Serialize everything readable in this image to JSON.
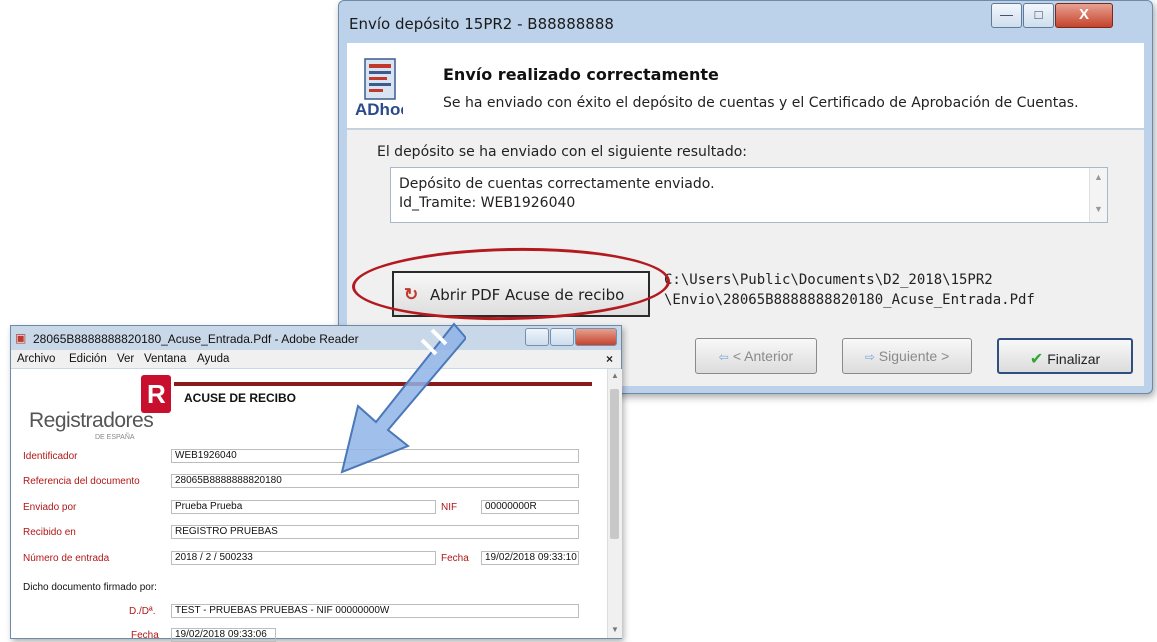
{
  "dialog": {
    "title": "Envío depósito 15PR2 - B88888888",
    "window_buttons": {
      "minimize": "—",
      "maximize": "□",
      "close": "X"
    },
    "header": {
      "logo_text": "ADhoc",
      "title": "Envío realizado correctamente",
      "subtitle": "Se ha enviado con éxito el depósito de cuentas y el Certificado de Aprobación de Cuentas."
    },
    "result_label": "El depósito se ha enviado con el siguiente resultado:",
    "result_lines": [
      "Depósito de cuentas correctamente enviado.",
      "Id_Tramite: WEB1926040"
    ],
    "pdf_button_label": "Abrir PDF Acuse de recibo",
    "path_line1": "C:\\Users\\Public\\Documents\\D2_2018\\15PR2",
    "path_line2": "\\Envio\\28065B8888888820180_Acuse_Entrada.Pdf",
    "nav": {
      "prev": "< Anterior",
      "next": "Siguiente >",
      "finish": "Finalizar"
    }
  },
  "reader": {
    "title": "28065B8888888820180_Acuse_Entrada.Pdf - Adobe Reader",
    "menu": [
      "Archivo",
      "Edición",
      "Ver",
      "Ventana",
      "Ayuda"
    ],
    "menu_close": "×",
    "doc": {
      "logo_letter": "R",
      "logo_name": "Registradores",
      "logo_sub": "DE ESPAÑA",
      "heading": "ACUSE DE RECIBO",
      "fields": {
        "identificador": {
          "label": "Identificador",
          "value": "WEB1926040"
        },
        "referencia": {
          "label": "Referencia del documento",
          "value": "28065B8888888820180"
        },
        "enviado": {
          "label": "Enviado por",
          "value": "Prueba Prueba"
        },
        "nif": {
          "label": "NIF",
          "value": "00000000R"
        },
        "recibido": {
          "label": "Recibido en",
          "value": "REGISTRO PRUEBAS"
        },
        "numero": {
          "label": "Número de entrada",
          "value": "2018 / 2 / 500233"
        },
        "fecha": {
          "label": "Fecha",
          "value": "19/02/2018 09:33:10"
        },
        "dicho": "Dicho documento firmado por:",
        "dd": {
          "label": "D./Dª.",
          "value": "TEST - PRUEBAS PRUEBAS - NIF 00000000W"
        },
        "fecha_firma": {
          "label": "Fecha",
          "value": "19/02/2018 09:33:06"
        }
      }
    }
  },
  "colors": {
    "highlight_ellipse": "#b3191f",
    "arrow": "#8fb4e6",
    "brand_red": "#c8102e"
  }
}
